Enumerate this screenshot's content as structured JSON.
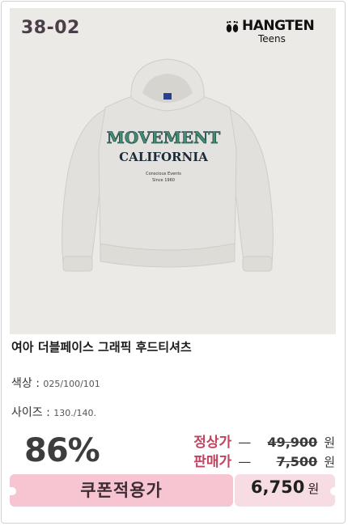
{
  "product": {
    "code": "38-02",
    "brand": {
      "name": "HANGTEN",
      "sub": "Teens"
    },
    "title": "여아 더블페이스 그래픽 후드티셔츠",
    "print_text": {
      "line1": "MOVEMENT",
      "line2": "CALIFORNIA",
      "line3": "Conscious Events",
      "line4": "Since 1960"
    },
    "colors": {
      "label": "색상",
      "separator": " : ",
      "value": "025/100/101"
    },
    "sizes": {
      "label": "사이즈",
      "separator": " : ",
      "value": "130./140."
    }
  },
  "pricing": {
    "discount": "86%",
    "regular_label": "정상가",
    "regular_price": "49,900",
    "sale_label": "판매가",
    "sale_price": "7,500",
    "currency": "원",
    "dash": "—"
  },
  "coupon": {
    "label": "쿠폰적용가",
    "price": "6,750",
    "currency": "원"
  },
  "theme": {
    "accent": "#c0445f",
    "coupon_bg": "#f6c5d1",
    "hoodie": "#e2e0dc",
    "print_green": "#3f8f6e"
  }
}
